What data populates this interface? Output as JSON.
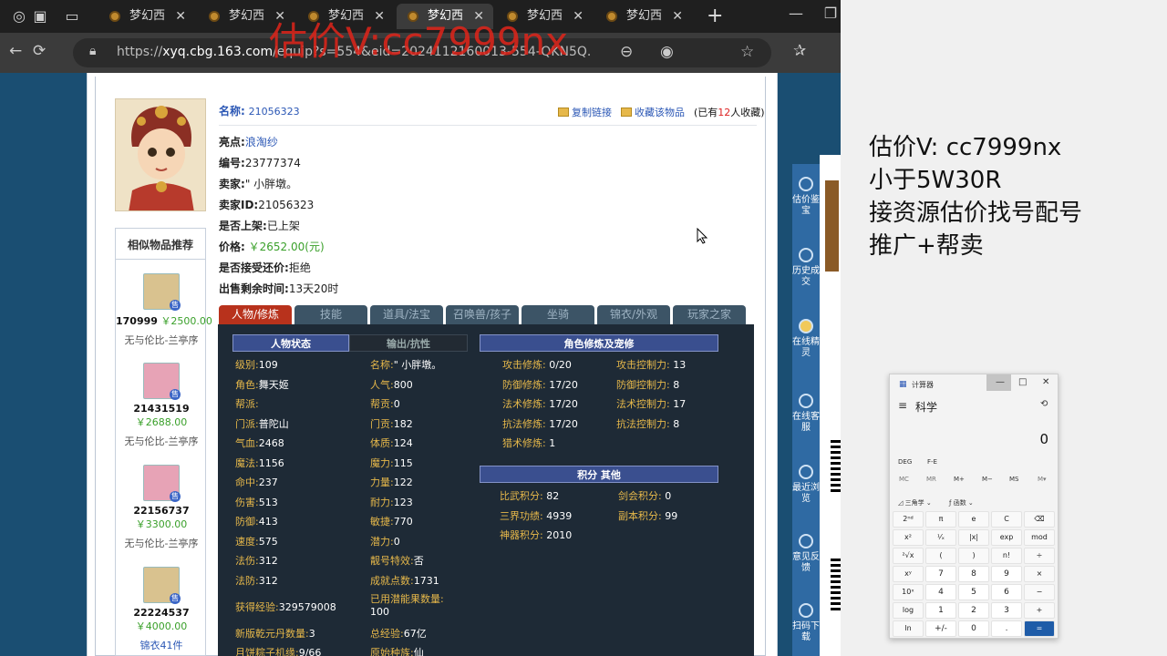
{
  "browser": {
    "tabs": [
      {
        "label": "梦幻西"
      },
      {
        "label": "梦幻西"
      },
      {
        "label": "梦幻西"
      },
      {
        "label": "梦幻西"
      },
      {
        "label": "梦幻西"
      },
      {
        "label": "梦幻西"
      }
    ],
    "url_pre": "https://",
    "url_host": "xyq.cbg.163.com",
    "url_rest": "/equip?s=554&eid=2024112160013-554-QKN5Q...",
    "watermark": "估价V:cc7999nx"
  },
  "item": {
    "name_label": "名称:",
    "name_value": "21056323",
    "copy_link": "复制链接",
    "favorite": "收藏该物品",
    "fav_count_pre": "(已有",
    "fav_count": "12",
    "fav_count_post": "人收藏)",
    "lines": [
      {
        "label": "亮点:",
        "value": "浪淘纱",
        "style": "link"
      },
      {
        "label": "编号:",
        "value": "23777374",
        "style": ""
      },
      {
        "label": "卖家:",
        "value": "\" 小胖墩。",
        "style": ""
      },
      {
        "label": "卖家ID:",
        "value": "21056323",
        "style": ""
      },
      {
        "label": "是否上架:",
        "value": "已上架",
        "style": ""
      },
      {
        "label": "价格:",
        "value": "￥2652.00(元)",
        "style": "price"
      },
      {
        "label": "是否接受还价:",
        "value": "拒绝",
        "style": ""
      },
      {
        "label": "出售剩余时间:",
        "value": "13天20时",
        "style": ""
      }
    ]
  },
  "sidebar": {
    "title": "相似物品推荐",
    "items": [
      {
        "id": "170999",
        "price": "￥2500.00",
        "server": "无与伦比-兰亭序",
        "sale": "售"
      },
      {
        "id": "21431519",
        "price": "￥2688.00",
        "server": "无与伦比-兰亭序",
        "sale": "售"
      },
      {
        "id": "22156737",
        "price": "￥3300.00",
        "server": "无与伦比-兰亭序",
        "sale": "售"
      },
      {
        "id": "22224537",
        "price": "￥4000.00",
        "server": "锦衣41件",
        "sale": "售"
      }
    ]
  },
  "game_tabs": [
    "人物/修炼",
    "技能",
    "道具/法宝",
    "召唤兽/孩子",
    "坐骑",
    "锦衣/外观",
    "玩家之家"
  ],
  "panel": {
    "hdr_status": "人物状态",
    "hdr_output": "输出/抗性",
    "hdr_cultivation": "角色修炼及宠修",
    "hdr_points": "积分 其他",
    "left_col": [
      {
        "k": "级别:",
        "v": "109"
      },
      {
        "k": "角色:",
        "v": "舞天姬"
      },
      {
        "k": "帮派:",
        "v": ""
      },
      {
        "k": "门派:",
        "v": "普陀山"
      },
      {
        "k": "气血:",
        "v": "2468"
      },
      {
        "k": "魔法:",
        "v": "1156"
      },
      {
        "k": "命中:",
        "v": "237"
      },
      {
        "k": "伤害:",
        "v": "513"
      },
      {
        "k": "防御:",
        "v": "413"
      },
      {
        "k": "速度:",
        "v": "575"
      },
      {
        "k": "法伤:",
        "v": "312"
      },
      {
        "k": "法防:",
        "v": "312"
      }
    ],
    "mid_col": [
      {
        "k": "名称:",
        "v": "\" 小胖墩。"
      },
      {
        "k": "人气:",
        "v": "800"
      },
      {
        "k": "帮贡:",
        "v": "0"
      },
      {
        "k": "门贡:",
        "v": "182"
      },
      {
        "k": "体质:",
        "v": "124"
      },
      {
        "k": "魔力:",
        "v": "115"
      },
      {
        "k": "力量:",
        "v": "122"
      },
      {
        "k": "耐力:",
        "v": "123"
      },
      {
        "k": "敏捷:",
        "v": "770"
      },
      {
        "k": "潜力:",
        "v": "0"
      },
      {
        "k": "靓号特效:",
        "v": "否"
      },
      {
        "k": "成就点数:",
        "v": "1731"
      }
    ],
    "exp": {
      "k": "获得经验:",
      "v": "329579008"
    },
    "potion": {
      "k": "已用潜能果数量:",
      "v": "100"
    },
    "pill": {
      "k": "新版乾元丹数量:",
      "v": "3"
    },
    "total_exp": {
      "k": "总经验:",
      "v": "67亿"
    },
    "mooncake": {
      "k": "月饼粽子机缘:",
      "v": "9/66"
    },
    "origin": {
      "k": "原始种族:",
      "v": "仙"
    },
    "cult_left": [
      {
        "k": "攻击修炼:",
        "v": "0/20"
      },
      {
        "k": "防御修炼:",
        "v": "17/20"
      },
      {
        "k": "法术修炼:",
        "v": "17/20"
      },
      {
        "k": "抗法修炼:",
        "v": "17/20"
      },
      {
        "k": "猎术修炼:",
        "v": "1"
      }
    ],
    "cult_right": [
      {
        "k": "攻击控制力:",
        "v": "13"
      },
      {
        "k": "防御控制力:",
        "v": "8"
      },
      {
        "k": "法术控制力:",
        "v": "17"
      },
      {
        "k": "抗法控制力:",
        "v": "8"
      }
    ],
    "points_left": [
      {
        "k": "比武积分:",
        "v": "82"
      },
      {
        "k": "三界功绩:",
        "v": "4939"
      },
      {
        "k": "神器积分:",
        "v": "2010"
      }
    ],
    "points_right": [
      {
        "k": "剑会积分:",
        "v": "0"
      },
      {
        "k": "副本积分:",
        "v": "99"
      }
    ]
  },
  "side_tools": [
    {
      "label": "估价鉴宝"
    },
    {
      "label": "历史成交"
    },
    {
      "label": "在线精灵"
    },
    {
      "label": "在线客服"
    },
    {
      "label": "最近浏览"
    },
    {
      "label": "意见反馈"
    },
    {
      "label": "扫码下载"
    }
  ],
  "ad_lines": [
    "估价V: cc7999nx",
    "小于5W30R",
    "接资源估价找号配号",
    "推广+帮卖"
  ],
  "calculator": {
    "title": "计算器",
    "mode": "科学",
    "display": "0",
    "deg": "DEG",
    "fe": "F-E",
    "mem": [
      "MC",
      "MR",
      "M+",
      "M−",
      "MS",
      "M▾"
    ],
    "trig": "三角学",
    "func": "函数",
    "keys": [
      "2ⁿᵈ",
      "π",
      "e",
      "C",
      "⌫",
      "x²",
      "¹⁄ₓ",
      "|x|",
      "exp",
      "mod",
      "²√x",
      "(",
      ")",
      "n!",
      "÷",
      "xʸ",
      "7",
      "8",
      "9",
      "×",
      "10ˣ",
      "4",
      "5",
      "6",
      "−",
      "log",
      "1",
      "2",
      "3",
      "+",
      "ln",
      "+/-",
      "0",
      ".",
      "="
    ]
  }
}
